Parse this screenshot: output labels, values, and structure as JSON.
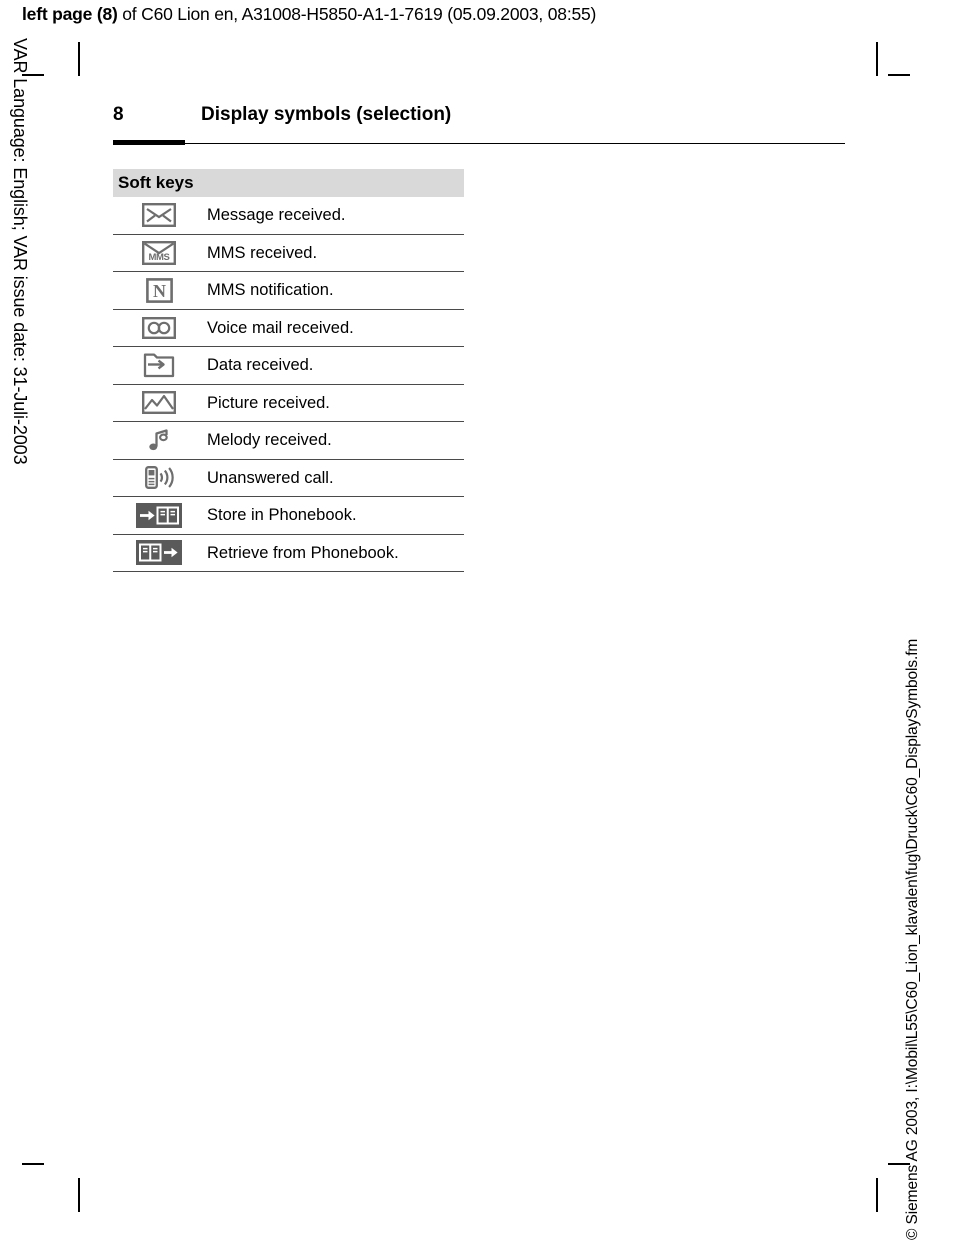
{
  "print_header": {
    "bold_part": "left page (8)",
    "rest_part": " of C60 Lion en, A31008-H5850-A1-1-7619 (05.09.2003, 08:55)"
  },
  "side_left_text": "VAR Language: English; VAR issue date: 31-Juli-2003",
  "side_right_text": "© Siemens AG 2003, I:\\Mobil\\L55\\C60_Lion_klavalen\\fug\\Druck\\C60_DisplaySymbols.fm",
  "page": {
    "number": "8",
    "chapter_title": "Display symbols (selection)"
  },
  "table": {
    "header": "Soft keys",
    "rows": [
      {
        "icon": "envelope-icon",
        "label": "Message received."
      },
      {
        "icon": "mms-envelope-icon",
        "label": "MMS received."
      },
      {
        "icon": "mms-notification-n-icon",
        "label": "MMS notification."
      },
      {
        "icon": "voicemail-cassette-icon",
        "label": "Voice mail received."
      },
      {
        "icon": "data-received-icon",
        "label": "Data received."
      },
      {
        "icon": "picture-received-icon",
        "label": "Picture received."
      },
      {
        "icon": "melody-note-icon",
        "label": "Melody received."
      },
      {
        "icon": "unanswered-call-icon",
        "label": "Unanswered call."
      },
      {
        "icon": "store-phonebook-icon",
        "label": "Store in Phonebook."
      },
      {
        "icon": "retrieve-phonebook-icon",
        "label": "Retrieve from Phonebook."
      }
    ]
  },
  "colors": {
    "header_band": "#d9d9d9",
    "rule": "#4a4a4a",
    "icon_gray": "#6e6e6e",
    "icon_dark": "#5a5a5a"
  }
}
